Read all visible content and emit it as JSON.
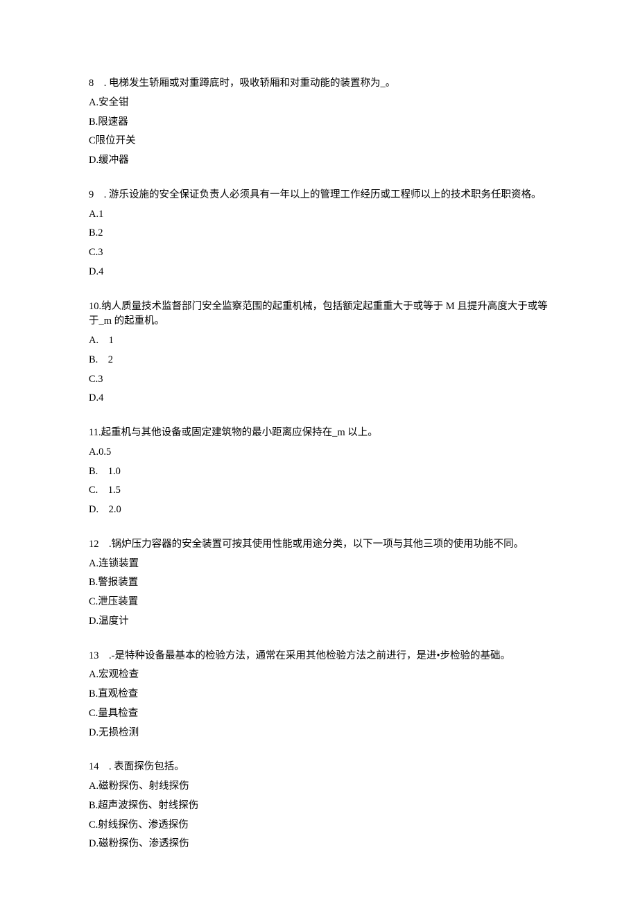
{
  "questions": [
    {
      "num": "8",
      "sep": "    . ",
      "text": "电梯发生轿厢或对重蹲底时，吸收轿厢和对重动能的装置称为_。",
      "options": [
        {
          "label": "A.",
          "text": "安全钳"
        },
        {
          "label": "B.",
          "text": "限速器"
        },
        {
          "label": "C",
          "text": "限位开关"
        },
        {
          "label": "D.",
          "text": "缓冲器"
        }
      ]
    },
    {
      "num": "9",
      "sep": "    . ",
      "text": "游乐设施的安全保证负责人必须具有一年以上的管理工作经历或工程师以上的技术职务任职资格。",
      "options": [
        {
          "label": "A.",
          "text": "1"
        },
        {
          "label": "B.",
          "text": "2"
        },
        {
          "label": "C.",
          "text": "3"
        },
        {
          "label": "D.",
          "text": "4"
        }
      ]
    },
    {
      "num": "10.",
      "sep": "",
      "text": "纳人质量技术监督部门安全监察范围的起重机械，包括额定起重重大于或等于 M 且提升高度大于或等于_m 的起重机。",
      "options": [
        {
          "label": "A.    ",
          "text": "1"
        },
        {
          "label": "B.    ",
          "text": "2"
        },
        {
          "label": "C.",
          "text": "3"
        },
        {
          "label": "D.",
          "text": "4"
        }
      ]
    },
    {
      "num": "11.",
      "sep": "",
      "text": "起重机与其他设备或固定建筑物的最小距离应保持在_m 以上。",
      "options": [
        {
          "label": "A.",
          "text": "0.5"
        },
        {
          "label": "B.    ",
          "text": "1.0"
        },
        {
          "label": "C.    ",
          "text": "1.5"
        },
        {
          "label": "D.    ",
          "text": "2.0"
        }
      ]
    },
    {
      "num": "12",
      "sep": "    .",
      "text": "锅炉压力容器的安全装置可按其使用性能或用途分类，以下一项与其他三项的使用功能不同。",
      "options": [
        {
          "label": "A.",
          "text": "连锁装置"
        },
        {
          "label": "B.",
          "text": "警报装置"
        },
        {
          "label": "C.",
          "text": "泄压装置"
        },
        {
          "label": "D.",
          "text": "温度计"
        }
      ]
    },
    {
      "num": "13",
      "sep": "    .",
      "text": "-是特种设备最基本的检验方法，通常在采用其他检验方法之前进行，是进•步检验的基础。",
      "options": [
        {
          "label": "A.",
          "text": "宏观检查"
        },
        {
          "label": "B.",
          "text": "直观检查"
        },
        {
          "label": "C.",
          "text": "量具检查"
        },
        {
          "label": "D.",
          "text": "无损检测"
        }
      ]
    },
    {
      "num": "14",
      "sep": "    . ",
      "text": "表面探伤包括。",
      "options": [
        {
          "label": "A.",
          "text": "磁粉探伤、射线探伤"
        },
        {
          "label": "B.",
          "text": "超声波探伤、射线探伤"
        },
        {
          "label": "C.",
          "text": "射线探伤、渗透探伤"
        },
        {
          "label": "D.",
          "text": "磁粉探伤、渗透探伤"
        }
      ]
    }
  ]
}
